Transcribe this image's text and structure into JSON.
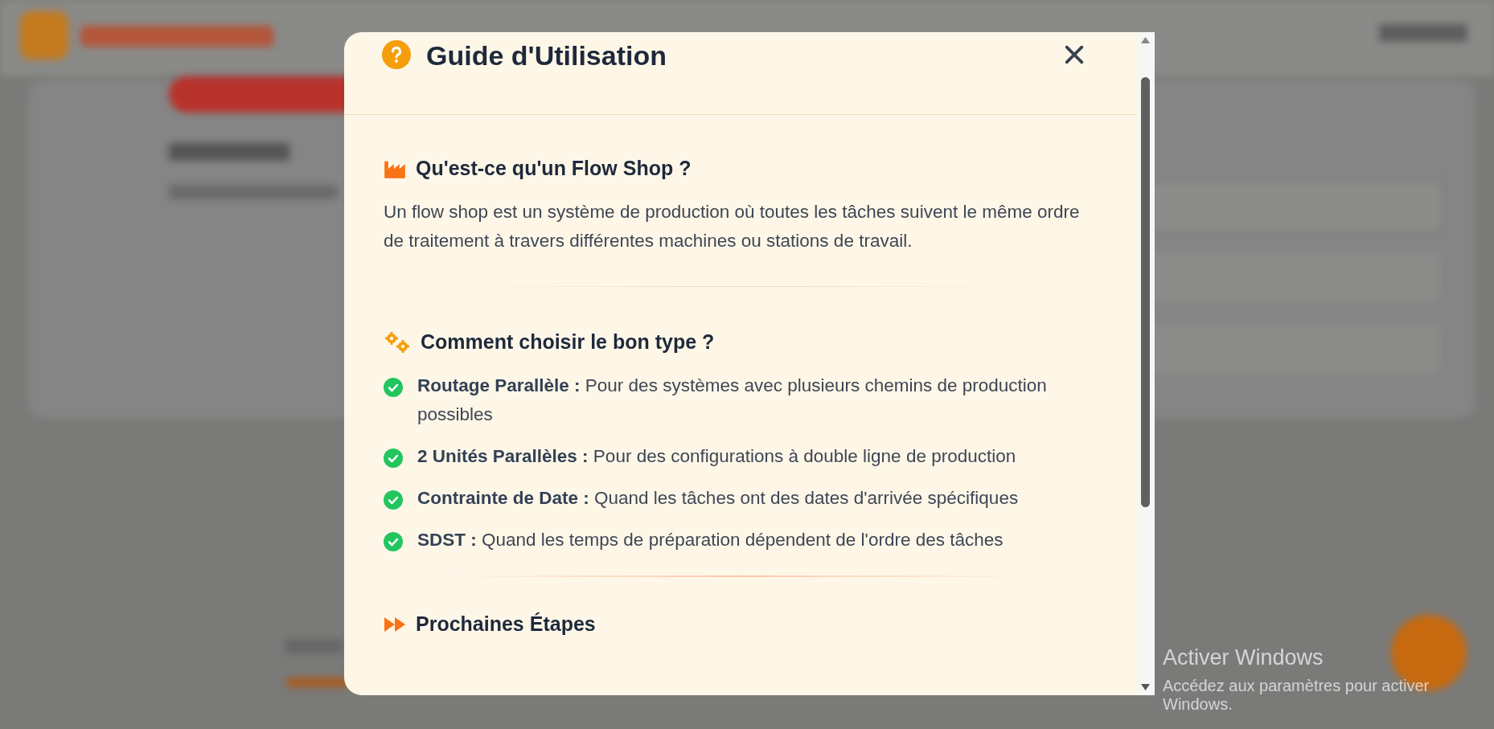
{
  "dialog": {
    "title": "Guide d'Utilisation",
    "sections": [
      {
        "kind": "paragraph",
        "heading": "Qu'est-ce qu'un Flow Shop ?",
        "text": "Un flow shop est un système de production où toutes les tâches suivent le même ordre de traitement à travers différentes machines ou stations de travail."
      },
      {
        "kind": "checklist",
        "heading": "Comment choisir le bon type ?",
        "items": [
          {
            "text": "**Routage Parallèle :** Pour des systèmes avec plusieurs chemins de production possibles"
          },
          {
            "text": "**2 Unités Parallèles :** Pour des configurations à double ligne de production"
          },
          {
            "text": "**Contrainte de Date :** Quand les tâches ont des dates d'arrivée spécifiques"
          },
          {
            "text": "**SDST :** Quand les temps de préparation dépendent de l'ordre des tâches"
          }
        ]
      },
      {
        "kind": "heading",
        "heading": "Prochaines Étapes"
      }
    ]
  },
  "os_notice": {
    "title": "Activer Windows",
    "text": "Accédez aux paramètres pour activer Windows."
  }
}
